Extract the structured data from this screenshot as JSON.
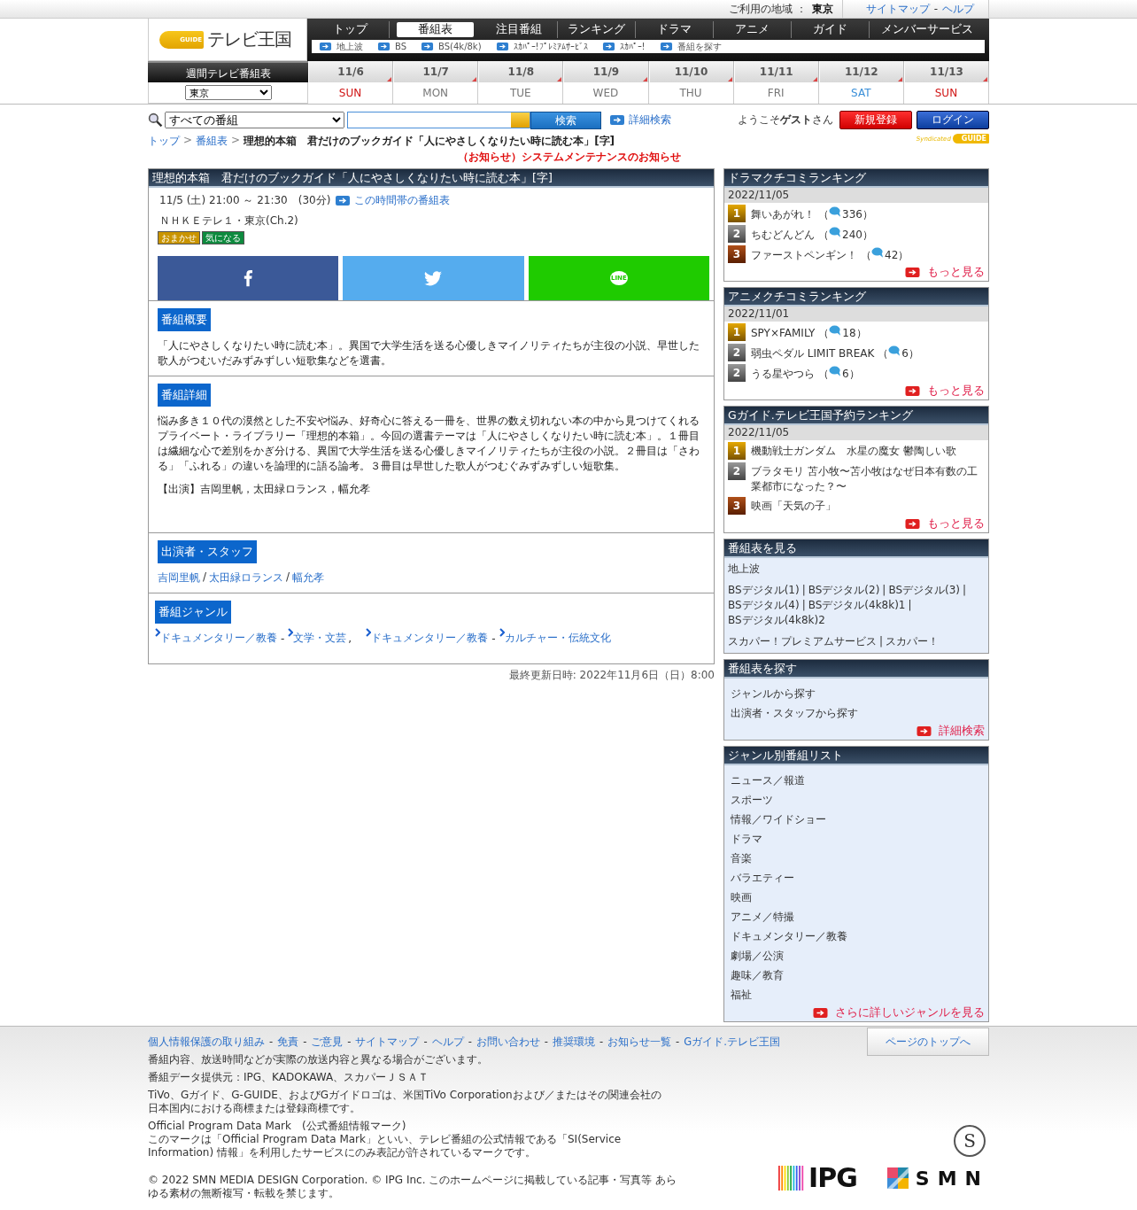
{
  "top_bar": {
    "area_label": "ご利用の地域 ：",
    "area": "東京",
    "links": [
      "サイトマップ",
      "ヘルプ"
    ],
    "separator": "-"
  },
  "logo": {
    "mark": "GUIDE",
    "name": "テレビ王国"
  },
  "nav": {
    "tabs": [
      {
        "label": "トップ",
        "selected": false
      },
      {
        "label": "番組表",
        "selected": true
      },
      {
        "label": "注目番組",
        "selected": false
      },
      {
        "label": "ランキング",
        "selected": false
      },
      {
        "label": "ドラマ",
        "selected": false
      },
      {
        "label": "アニメ",
        "selected": false
      },
      {
        "label": "ガイド",
        "selected": false
      },
      {
        "label": "メンバーサービス",
        "selected": false
      }
    ],
    "sublinks": [
      "地上波",
      "BS",
      "BS(4k/8k)",
      "ｽｶﾊﾟｰ!ﾌﾟﾚﾐｱﾑｻｰﾋﾞｽ",
      "ｽｶﾊﾟｰ!",
      "番組を探す"
    ]
  },
  "week": {
    "title": "週間テレビ番組表",
    "region": "東京",
    "days": [
      {
        "date": "11/6",
        "weekday": "SUN",
        "kind": "sun"
      },
      {
        "date": "11/7",
        "weekday": "MON",
        "kind": "weekday"
      },
      {
        "date": "11/8",
        "weekday": "TUE",
        "kind": "weekday"
      },
      {
        "date": "11/9",
        "weekday": "WED",
        "kind": "weekday"
      },
      {
        "date": "11/10",
        "weekday": "THU",
        "kind": "weekday"
      },
      {
        "date": "11/11",
        "weekday": "FRI",
        "kind": "weekday"
      },
      {
        "date": "11/12",
        "weekday": "SAT",
        "kind": "sat"
      },
      {
        "date": "11/13",
        "weekday": "SUN",
        "kind": "sun"
      }
    ]
  },
  "search": {
    "scope": "すべての番組",
    "button": "検索",
    "advanced": "詳細検索"
  },
  "account": {
    "welcome": "ようこそ**ゲスト**さん",
    "register": "新規登録",
    "login": "ログイン",
    "badge": "Syndicated",
    "badge_mark": "GUIDE"
  },
  "breadcrumb": {
    "separator": ">",
    "items": [
      {
        "label": "トップ",
        "kind": "link"
      },
      {
        "label": "番組表",
        "kind": "link"
      },
      {
        "label": "理想的本箱　君だけのブックガイド「人にやさしくなりたい時に読む本」[字]",
        "kind": "current"
      }
    ]
  },
  "notice": "（お知らせ）システムメンテナンスのお知らせ",
  "program": {
    "title": "理想的本箱　君だけのブックガイド「人にやさしくなりたい時に読む本」[字]",
    "datetime": "11/5 (土) 21:00 ～ 21:30　(30分)",
    "schedule_link": "この時間帯の番組表",
    "channel": "ＮＨＫＥテレ１・東京(Ch.2)",
    "tags": [
      {
        "label": "おまかせ",
        "color": "#c99400"
      },
      {
        "label": "気になる",
        "color": "#0e8a3e"
      }
    ],
    "share": [
      {
        "kind": "facebook"
      },
      {
        "kind": "twitter"
      },
      {
        "kind": "line",
        "label": "LINE"
      }
    ]
  },
  "overview": {
    "heading": "番組概要",
    "text": "「人にやさしくなりたい時に読む本」。異国で大学生活を送る心優しきマイノリティたちが主役の小説、早世した歌人がつむいだみずみずしい短歌集などを選書。"
  },
  "detail": {
    "heading": "番組詳細",
    "paragraphs": [
      "悩み多き１０代の漠然とした不安や悩み、好奇心に答える一冊を、世界の数え切れない本の中から見つけてくれるプライベート・ライブラリー「理想的本箱」。今回の選書テーマは「人にやさしくなりたい時に読む本」。１冊目は繊細な心で差別をかぎ分ける、異国で大学生活を送る心優しきマイノリティたちが主役の小説。２冊目は「さわる」「ふれる」の違いを論理的に語る論考。３冊目は早世した歌人がつむぐみずみずしい短歌集。",
      "【出演】吉岡里帆，太田緑ロランス，幅允孝"
    ]
  },
  "cast": {
    "heading": "出演者・スタッフ",
    "separator": "/",
    "names": [
      "吉岡里帆",
      "太田緑ロランス",
      "幅允孝"
    ]
  },
  "genres": {
    "heading": "番組ジャンル",
    "pair_separator": "-",
    "group_separator": ",",
    "groups": [
      {
        "main": "ドキュメンタリー／教養",
        "sub": "文学・文芸"
      },
      {
        "main": "ドキュメンタリー／教養",
        "sub": "カルチャー・伝統文化"
      }
    ]
  },
  "updated": "最終更新日時: 2022年11月6日（日）8:00",
  "rankings": [
    {
      "title": "ドラマクチコミランキング",
      "date": "2022/11/05",
      "more": "もっと見る",
      "items": [
        {
          "rank": "1",
          "kind": "gold",
          "title": "舞いあがれ！",
          "open": "（",
          "count": "336）"
        },
        {
          "rank": "2",
          "kind": "silver",
          "title": "ちむどんどん",
          "open": "（",
          "count": "240）"
        },
        {
          "rank": "3",
          "kind": "bronze",
          "title": "ファーストペンギン！",
          "open": "（",
          "count": "42）"
        }
      ]
    },
    {
      "title": "アニメクチコミランキング",
      "date": "2022/11/01",
      "more": "もっと見る",
      "items": [
        {
          "rank": "1",
          "kind": "gold",
          "title": "SPY×FAMILY",
          "open": "（",
          "count": "18）"
        },
        {
          "rank": "2",
          "kind": "silver",
          "title": "弱虫ペダル LIMIT BREAK",
          "open": "（",
          "count": "6）"
        },
        {
          "rank": "2",
          "kind": "silver",
          "title": "うる星やつら",
          "open": "（",
          "count": "6）"
        }
      ]
    },
    {
      "title": "Gガイド.テレビ王国予約ランキング",
      "date": "2022/11/05",
      "more": "もっと見る",
      "items": [
        {
          "rank": "1",
          "kind": "gold",
          "title": "機動戦士ガンダム　水星の魔女 鬱陶しい歌"
        },
        {
          "rank": "2",
          "kind": "silver",
          "title": "ブラタモリ 苫小牧〜苫小牧はなぜ日本有数の工業都市になった？〜"
        },
        {
          "rank": "3",
          "kind": "bronze",
          "title": "映画「天気の子」"
        }
      ]
    }
  ],
  "timetables": {
    "title": "番組表を見る",
    "separator": "|",
    "groups": [
      [
        "地上波"
      ],
      [
        "BSデジタル(1)",
        "BSデジタル(2)",
        "BSデジタル(3)",
        "BSデジタル(4)",
        "BSデジタル(4k8k)1",
        "BSデジタル(4k8k)2"
      ],
      [
        "スカパー！プレミアムサービス",
        "スカパー！"
      ]
    ]
  },
  "find": {
    "title": "番組表を探す",
    "links": [
      "ジャンルから探す",
      "出演者・スタッフから探す"
    ],
    "more": "詳細検索"
  },
  "genre_list": {
    "title": "ジャンル別番組リスト",
    "items": [
      "ニュース／報道",
      "スポーツ",
      "情報／ワイドショー",
      "ドラマ",
      "音楽",
      "バラエティー",
      "映画",
      "アニメ／特撮",
      "ドキュメンタリー／教養",
      "劇場／公演",
      "趣味／教育",
      "福祉"
    ],
    "more": "さらに詳しいジャンルを見る"
  },
  "footer": {
    "separator": "-",
    "links": [
      "個人情報保護の取り組み",
      "免責",
      "ご意見",
      "サイトマップ",
      "ヘルプ",
      "お問い合わせ",
      "推奨環境",
      "お知らせ一覧",
      "Gガイド.テレビ王国"
    ],
    "top_button": "ページのトップへ",
    "notes": [
      [
        "番組内容、放送時間などが実際の放送内容と異なる場合がございます。"
      ],
      [
        "番組データ提供元：IPG、KADOKAWA、スカパーＪＳＡＴ"
      ],
      [
        "TiVo、Gガイド、G-GUIDE、およびGガイドロゴは、米国TiVo Corporationおよび／またはその関連会社の",
        "日本国内における商標または登録商標です。"
      ],
      [
        "Official Program Data Mark　(公式番組情報マーク)",
        "このマークは「Official Program Data Mark」といい、テレビ番組の公式情報である「SI(Service",
        "Information) 情報」を利用したサービスにのみ表記が許されているマークです。"
      ]
    ],
    "mark": "S",
    "copyright": "© 2022 SMN MEDIA DESIGN Corporation. © IPG Inc. このホームページに掲載している記事・写真等 あらゆる素材の無断複写・転載を禁じます。",
    "logos": [
      "IPG",
      "SMN"
    ]
  }
}
